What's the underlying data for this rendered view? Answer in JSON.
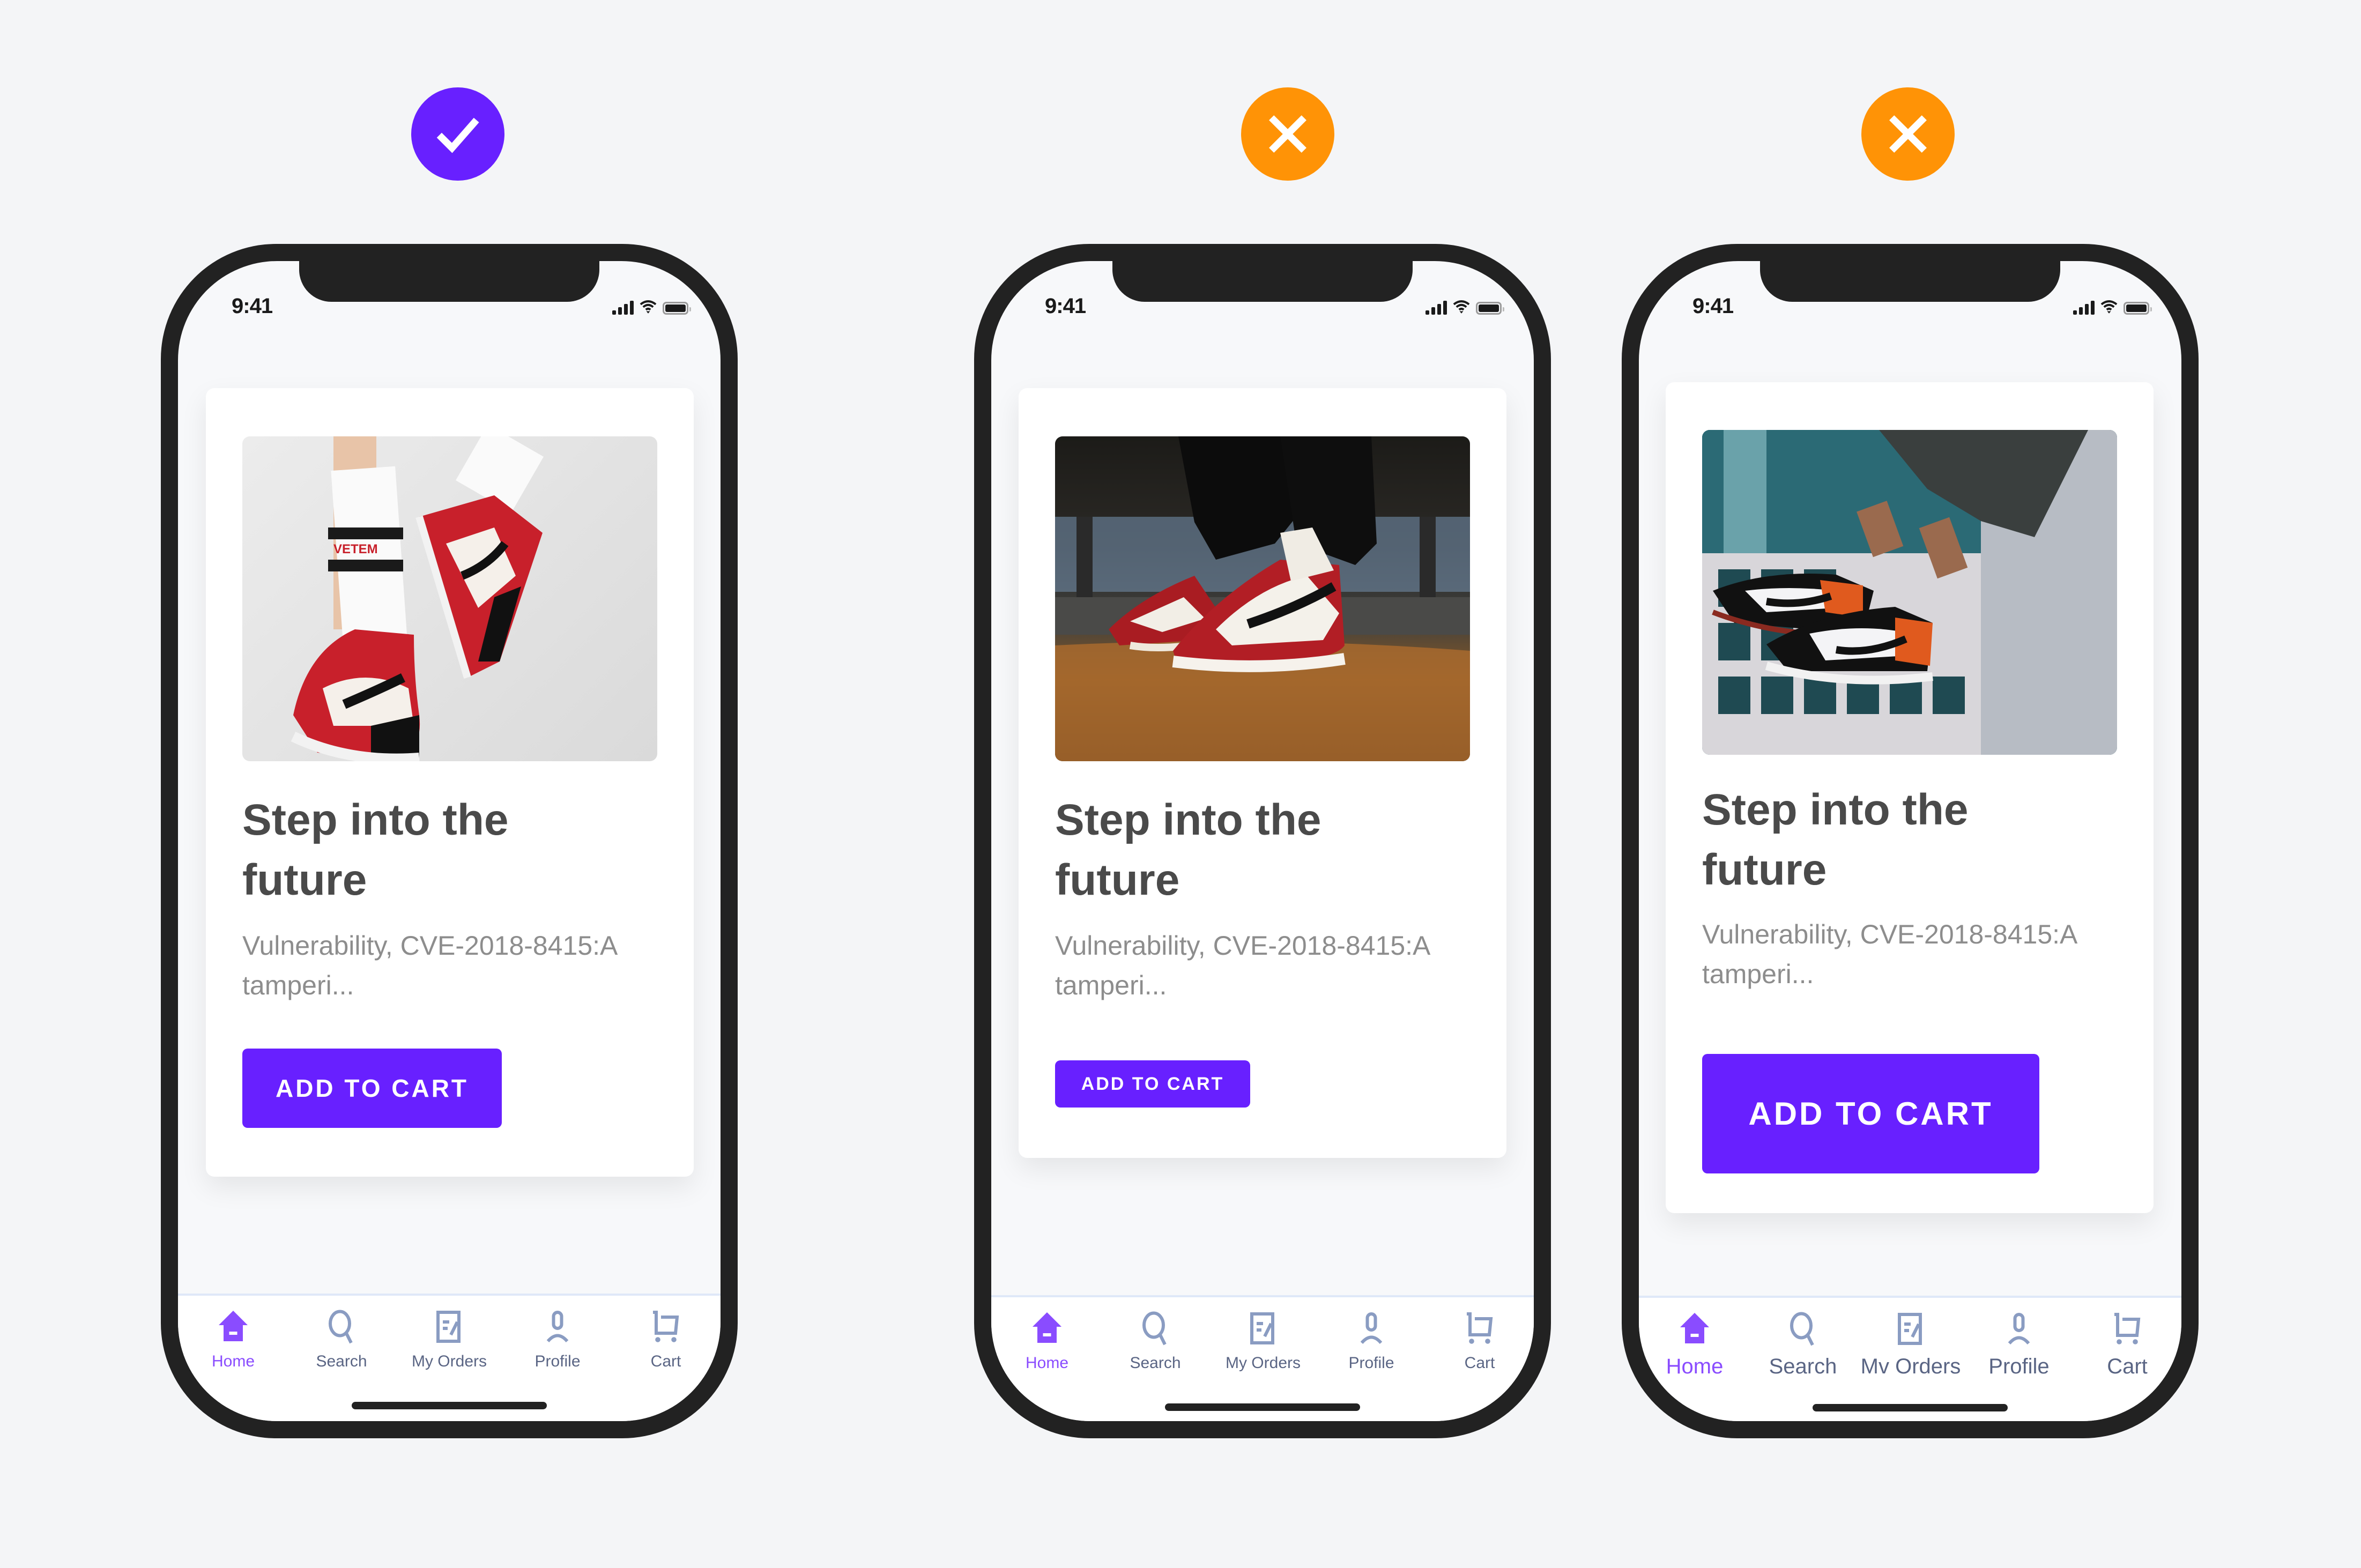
{
  "verdicts": [
    {
      "type": "correct",
      "icon": "check-icon",
      "color": "#6820ff"
    },
    {
      "type": "incorrect",
      "icon": "close-icon",
      "color": "#ff9306"
    },
    {
      "type": "incorrect",
      "icon": "close-icon",
      "color": "#ff9306"
    }
  ],
  "colors": {
    "accent": "#6820ff",
    "warning": "#ff9306",
    "nav_active": "#8a4cff",
    "nav_inactive": "#8a9cc2",
    "title_text": "#4a4a4a",
    "body_text": "#8d8d8d",
    "frame": "#222222",
    "background": "#f4f5f7"
  },
  "phones": [
    {
      "status": {
        "time": "9:41"
      },
      "card": {
        "image_alt": "Red, black and white high-top sneakers with striped socks on white background",
        "title_line1": "Step into the",
        "title_line2": "future",
        "desc_line1": "Vulnerability, CVE-2018-8415:A",
        "desc_line2": "tamperi...",
        "button_label": "ADD TO CART"
      },
      "nav": [
        "Home",
        "Search",
        "My Orders",
        "Profile",
        "Cart"
      ],
      "active_nav": "Home"
    },
    {
      "status": {
        "time": "9:41"
      },
      "card": {
        "image_alt": "Red and white high-top sneakers on a warehouse floor",
        "title_line1": "Step into the",
        "title_line2": "future",
        "desc_line1": "Vulnerability, CVE-2018-8415:A",
        "desc_line2": "tamperi...",
        "button_label": "ADD TO CART"
      },
      "nav": [
        "Home",
        "Search",
        "My Orders",
        "Profile",
        "Cart"
      ],
      "active_nav": "Home"
    },
    {
      "status": {
        "time": "9:41"
      },
      "card": {
        "image_alt": "Black, white and orange low-top sneakers dangling over a city building",
        "title_line1": "Step into the",
        "title_line2": "future",
        "desc_line1": "Vulnerability, CVE-2018-8415:A",
        "desc_line2": "tamperi...",
        "button_label": "ADD TO CART"
      },
      "nav": [
        "Home",
        "Search",
        "Mv Orders",
        "Profile",
        "Cart"
      ],
      "active_nav": "Home"
    }
  ]
}
